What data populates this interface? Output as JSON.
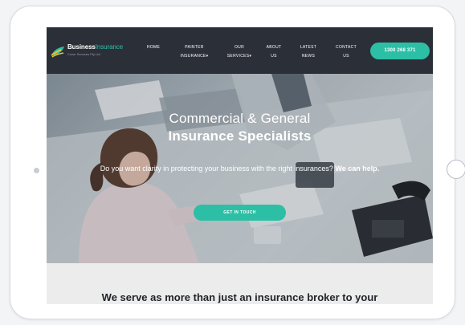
{
  "logo": {
    "title_main": "Business",
    "title_accent": "Insurance",
    "subtitle": "Cover Services Pty Ltd"
  },
  "nav": {
    "items": [
      {
        "line1": "HOME",
        "line2": ""
      },
      {
        "line1": "PAINTER",
        "line2": "INSURANCE▾"
      },
      {
        "line1": "OUR",
        "line2": "SERVICES▾"
      },
      {
        "line1": "ABOUT",
        "line2": "US"
      },
      {
        "line1": "LATEST",
        "line2": "NEWS"
      },
      {
        "line1": "CONTACT",
        "line2": "US"
      }
    ],
    "phone": "1300 268 371"
  },
  "hero": {
    "title_line1": "Commercial & General",
    "title_line2": "Insurance Specialists",
    "text_regular": "Do you want clarity in protecting your business with the right insurances?",
    "text_bold": "We can help.",
    "button": "GET IN TOUCH"
  },
  "intro": {
    "heading": "We serve as more than just an insurance broker to your"
  },
  "colors": {
    "accent": "#2dbfa6",
    "navbar": "#2b2f38"
  }
}
